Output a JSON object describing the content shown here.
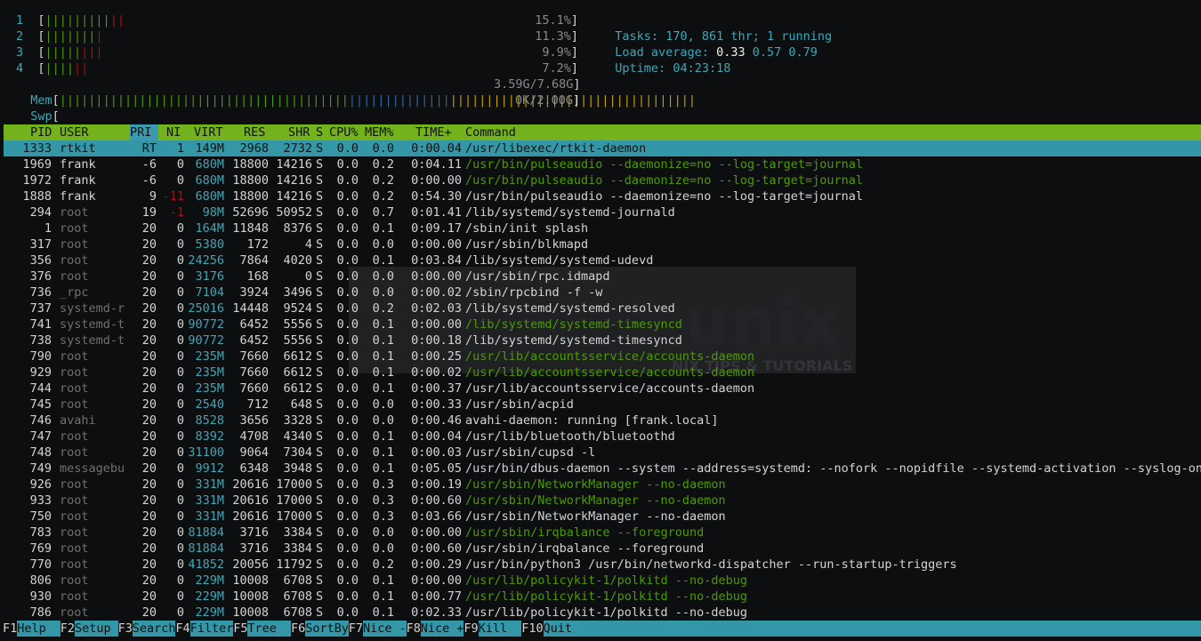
{
  "cpus": [
    {
      "label": "1",
      "green": "|||||||||",
      "red": "||",
      "pct": "15.1%"
    },
    {
      "label": "2",
      "green": "|||||||",
      "red": "|",
      "pct": "11.3%"
    },
    {
      "label": "3",
      "green": "|||||",
      "red": "|||",
      "pct": "9.9%"
    },
    {
      "label": "4",
      "green": "||||",
      "red": "||",
      "pct": "7.2%"
    }
  ],
  "mem": {
    "label": "Mem",
    "green": "||||||||||||||||||||||||||||||||||||||||",
    "blue": "||||||||||||||",
    "yellow": "||||||||||||||||||||||||||||||||||",
    "value": "3.59G/7.68G"
  },
  "swp": {
    "label": "Swp",
    "value": "0K/2.00G"
  },
  "summary": {
    "tasks_label": "Tasks:",
    "tasks": "170,",
    "threads": "861 thr;",
    "running": "1 running",
    "load_label": "Load average:",
    "load1": "0.33",
    "load5": "0.57",
    "load15": "0.79",
    "uptime_label": "Uptime:",
    "uptime": "04:23:18"
  },
  "columns": {
    "pid": "PID",
    "user": "USER",
    "pri": "PRI",
    "ni": "NI",
    "virt": "VIRT",
    "res": "RES",
    "shr": "SHR",
    "s": "S",
    "cpu": "CPU%",
    "mem": "MEM%",
    "time": "TIME+",
    "cmd": "Command"
  },
  "processes": [
    {
      "pid": "1333",
      "user": "rtkit",
      "pri": "RT",
      "ni": "1",
      "virt": "149M",
      "res": "2968",
      "shr": "2732",
      "s": "S",
      "cpu": "0.0",
      "mem": "0.0",
      "time": "0:00.04",
      "cmd": "/usr/libexec/rtkit-daemon",
      "sel": true
    },
    {
      "pid": "1969",
      "user": "frank",
      "pri": "-6",
      "ni": "0",
      "virt": "680M",
      "res": "18800",
      "shr": "14216",
      "s": "S",
      "cpu": "0.0",
      "mem": "0.2",
      "time": "0:04.11",
      "cmd": "/usr/bin/pulseaudio --daemonize=no --log-target=journal",
      "thread": true
    },
    {
      "pid": "1972",
      "user": "frank",
      "pri": "-6",
      "ni": "0",
      "virt": "680M",
      "res": "18800",
      "shr": "14216",
      "s": "S",
      "cpu": "0.0",
      "mem": "0.2",
      "time": "0:00.00",
      "cmd": "/usr/bin/pulseaudio --daemonize=no --log-target=journal",
      "thread": true
    },
    {
      "pid": "1888",
      "user": "frank",
      "pri": "9",
      "ni": "-11",
      "virt": "680M",
      "res": "18800",
      "shr": "14216",
      "s": "S",
      "cpu": "0.0",
      "mem": "0.2",
      "time": "0:54.30",
      "cmd": "/usr/bin/pulseaudio --daemonize=no --log-target=journal"
    },
    {
      "pid": "294",
      "user": "root",
      "pri": "19",
      "ni": "-1",
      "virt": "98M",
      "res": "52696",
      "shr": "50952",
      "s": "S",
      "cpu": "0.0",
      "mem": "0.7",
      "time": "0:01.41",
      "cmd": "/lib/systemd/systemd-journald"
    },
    {
      "pid": "1",
      "user": "root",
      "pri": "20",
      "ni": "0",
      "virt": "164M",
      "res": "11848",
      "shr": "8376",
      "s": "S",
      "cpu": "0.0",
      "mem": "0.1",
      "time": "0:09.17",
      "cmd": "/sbin/init splash"
    },
    {
      "pid": "317",
      "user": "root",
      "pri": "20",
      "ni": "0",
      "virt": "5380",
      "res": "172",
      "shr": "4",
      "s": "S",
      "cpu": "0.0",
      "mem": "0.0",
      "time": "0:00.00",
      "cmd": "/usr/sbin/blkmapd"
    },
    {
      "pid": "356",
      "user": "root",
      "pri": "20",
      "ni": "0",
      "virt": "24256",
      "res": "7864",
      "shr": "4020",
      "s": "S",
      "cpu": "0.0",
      "mem": "0.1",
      "time": "0:03.84",
      "cmd": "/lib/systemd/systemd-udevd"
    },
    {
      "pid": "376",
      "user": "root",
      "pri": "20",
      "ni": "0",
      "virt": "3176",
      "res": "168",
      "shr": "0",
      "s": "S",
      "cpu": "0.0",
      "mem": "0.0",
      "time": "0:00.00",
      "cmd": "/usr/sbin/rpc.idmapd"
    },
    {
      "pid": "736",
      "user": "_rpc",
      "pri": "20",
      "ni": "0",
      "virt": "7104",
      "res": "3924",
      "shr": "3496",
      "s": "S",
      "cpu": "0.0",
      "mem": "0.0",
      "time": "0:00.02",
      "cmd": "/sbin/rpcbind -f -w"
    },
    {
      "pid": "737",
      "user": "systemd-r",
      "pri": "20",
      "ni": "0",
      "virt": "25016",
      "res": "14448",
      "shr": "9524",
      "s": "S",
      "cpu": "0.0",
      "mem": "0.2",
      "time": "0:02.03",
      "cmd": "/lib/systemd/systemd-resolved"
    },
    {
      "pid": "741",
      "user": "systemd-t",
      "pri": "20",
      "ni": "0",
      "virt": "90772",
      "res": "6452",
      "shr": "5556",
      "s": "S",
      "cpu": "0.0",
      "mem": "0.1",
      "time": "0:00.00",
      "cmd": "/lib/systemd/systemd-timesyncd",
      "thread": true
    },
    {
      "pid": "738",
      "user": "systemd-t",
      "pri": "20",
      "ni": "0",
      "virt": "90772",
      "res": "6452",
      "shr": "5556",
      "s": "S",
      "cpu": "0.0",
      "mem": "0.1",
      "time": "0:00.18",
      "cmd": "/lib/systemd/systemd-timesyncd"
    },
    {
      "pid": "790",
      "user": "root",
      "pri": "20",
      "ni": "0",
      "virt": "235M",
      "res": "7660",
      "shr": "6612",
      "s": "S",
      "cpu": "0.0",
      "mem": "0.1",
      "time": "0:00.25",
      "cmd": "/usr/lib/accountsservice/accounts-daemon",
      "thread": true
    },
    {
      "pid": "929",
      "user": "root",
      "pri": "20",
      "ni": "0",
      "virt": "235M",
      "res": "7660",
      "shr": "6612",
      "s": "S",
      "cpu": "0.0",
      "mem": "0.1",
      "time": "0:00.02",
      "cmd": "/usr/lib/accountsservice/accounts-daemon",
      "thread": true
    },
    {
      "pid": "744",
      "user": "root",
      "pri": "20",
      "ni": "0",
      "virt": "235M",
      "res": "7660",
      "shr": "6612",
      "s": "S",
      "cpu": "0.0",
      "mem": "0.1",
      "time": "0:00.37",
      "cmd": "/usr/lib/accountsservice/accounts-daemon"
    },
    {
      "pid": "745",
      "user": "root",
      "pri": "20",
      "ni": "0",
      "virt": "2540",
      "res": "712",
      "shr": "648",
      "s": "S",
      "cpu": "0.0",
      "mem": "0.0",
      "time": "0:00.33",
      "cmd": "/usr/sbin/acpid"
    },
    {
      "pid": "746",
      "user": "avahi",
      "pri": "20",
      "ni": "0",
      "virt": "8528",
      "res": "3656",
      "shr": "3328",
      "s": "S",
      "cpu": "0.0",
      "mem": "0.0",
      "time": "0:00.46",
      "cmd": "avahi-daemon: running [frank.local]"
    },
    {
      "pid": "747",
      "user": "root",
      "pri": "20",
      "ni": "0",
      "virt": "8392",
      "res": "4708",
      "shr": "4340",
      "s": "S",
      "cpu": "0.0",
      "mem": "0.1",
      "time": "0:00.04",
      "cmd": "/usr/lib/bluetooth/bluetoothd"
    },
    {
      "pid": "748",
      "user": "root",
      "pri": "20",
      "ni": "0",
      "virt": "31100",
      "res": "9064",
      "shr": "7304",
      "s": "S",
      "cpu": "0.0",
      "mem": "0.1",
      "time": "0:00.03",
      "cmd": "/usr/sbin/cupsd -l"
    },
    {
      "pid": "749",
      "user": "messagebu",
      "pri": "20",
      "ni": "0",
      "virt": "9912",
      "res": "6348",
      "shr": "3948",
      "s": "S",
      "cpu": "0.0",
      "mem": "0.1",
      "time": "0:05.05",
      "cmd": "/usr/bin/dbus-daemon --system --address=systemd: --nofork --nopidfile --systemd-activation --syslog-onl"
    },
    {
      "pid": "926",
      "user": "root",
      "pri": "20",
      "ni": "0",
      "virt": "331M",
      "res": "20616",
      "shr": "17000",
      "s": "S",
      "cpu": "0.0",
      "mem": "0.3",
      "time": "0:00.19",
      "cmd": "/usr/sbin/NetworkManager --no-daemon",
      "thread": true
    },
    {
      "pid": "933",
      "user": "root",
      "pri": "20",
      "ni": "0",
      "virt": "331M",
      "res": "20616",
      "shr": "17000",
      "s": "S",
      "cpu": "0.0",
      "mem": "0.3",
      "time": "0:00.60",
      "cmd": "/usr/sbin/NetworkManager --no-daemon",
      "thread": true
    },
    {
      "pid": "750",
      "user": "root",
      "pri": "20",
      "ni": "0",
      "virt": "331M",
      "res": "20616",
      "shr": "17000",
      "s": "S",
      "cpu": "0.0",
      "mem": "0.3",
      "time": "0:03.66",
      "cmd": "/usr/sbin/NetworkManager --no-daemon"
    },
    {
      "pid": "783",
      "user": "root",
      "pri": "20",
      "ni": "0",
      "virt": "81884",
      "res": "3716",
      "shr": "3384",
      "s": "S",
      "cpu": "0.0",
      "mem": "0.0",
      "time": "0:00.00",
      "cmd": "/usr/sbin/irqbalance --foreground",
      "thread": true
    },
    {
      "pid": "769",
      "user": "root",
      "pri": "20",
      "ni": "0",
      "virt": "81884",
      "res": "3716",
      "shr": "3384",
      "s": "S",
      "cpu": "0.0",
      "mem": "0.0",
      "time": "0:00.60",
      "cmd": "/usr/sbin/irqbalance --foreground"
    },
    {
      "pid": "770",
      "user": "root",
      "pri": "20",
      "ni": "0",
      "virt": "41852",
      "res": "20056",
      "shr": "11792",
      "s": "S",
      "cpu": "0.0",
      "mem": "0.2",
      "time": "0:00.29",
      "cmd": "/usr/bin/python3 /usr/bin/networkd-dispatcher --run-startup-triggers"
    },
    {
      "pid": "806",
      "user": "root",
      "pri": "20",
      "ni": "0",
      "virt": "229M",
      "res": "10008",
      "shr": "6708",
      "s": "S",
      "cpu": "0.0",
      "mem": "0.1",
      "time": "0:00.00",
      "cmd": "/usr/lib/policykit-1/polkitd --no-debug",
      "thread": true
    },
    {
      "pid": "930",
      "user": "root",
      "pri": "20",
      "ni": "0",
      "virt": "229M",
      "res": "10008",
      "shr": "6708",
      "s": "S",
      "cpu": "0.0",
      "mem": "0.1",
      "time": "0:00.77",
      "cmd": "/usr/lib/policykit-1/polkitd --no-debug",
      "thread": true
    },
    {
      "pid": "786",
      "user": "root",
      "pri": "20",
      "ni": "0",
      "virt": "229M",
      "res": "10008",
      "shr": "6708",
      "s": "S",
      "cpu": "0.0",
      "mem": "0.1",
      "time": "0:02.33",
      "cmd": "/usr/lib/policykit-1/polkitd --no-debug"
    }
  ],
  "footer": [
    {
      "key": "F1",
      "label": "Help  "
    },
    {
      "key": "F2",
      "label": "Setup "
    },
    {
      "key": "F3",
      "label": "Search"
    },
    {
      "key": "F4",
      "label": "Filter"
    },
    {
      "key": "F5",
      "label": "Tree  "
    },
    {
      "key": "F6",
      "label": "SortBy"
    },
    {
      "key": "F7",
      "label": "Nice -"
    },
    {
      "key": "F8",
      "label": "Nice +"
    },
    {
      "key": "F9",
      "label": "Kill  "
    },
    {
      "key": "F10",
      "label": "Quit"
    }
  ],
  "watermark": {
    "brand": "unix",
    "tagline": "NIX TIPS & TUTORIALS"
  },
  "colors": {
    "header_bg": "#73b21c",
    "selected_bg": "#3397a8",
    "cyan": "#3fa7b8",
    "green": "#4e9a06",
    "red": "#cc0000"
  }
}
